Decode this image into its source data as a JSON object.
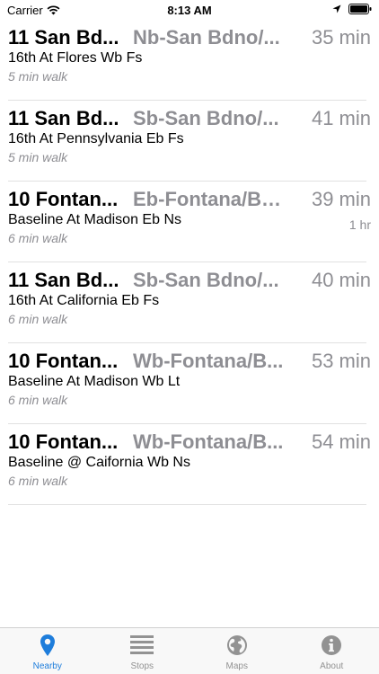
{
  "status_bar": {
    "carrier": "Carrier",
    "time": "8:13 AM",
    "icons": [
      "wifi-icon",
      "location-arrow-icon",
      "battery-icon"
    ]
  },
  "departures": [
    {
      "route": "11 San Bd...",
      "headsign": "Nb-San Bdno/...",
      "eta": "35 min",
      "eta_secondary": "",
      "stop": "16th At Flores Wb Fs",
      "walk": "5 min walk"
    },
    {
      "route": "11 San Bd...",
      "headsign": "Sb-San Bdno/...",
      "eta": "41 min",
      "eta_secondary": "",
      "stop": "16th At Pennsylvania Eb Fs",
      "walk": "5 min walk"
    },
    {
      "route": "10 Fontan...",
      "headsign": "Eb-Fontana/Ba...",
      "eta": "39 min",
      "eta_secondary": "1 hr",
      "stop": "Baseline At Madison Eb Ns",
      "walk": "6 min walk"
    },
    {
      "route": "11 San Bd...",
      "headsign": "Sb-San Bdno/...",
      "eta": "40 min",
      "eta_secondary": "",
      "stop": "16th At California Eb Fs",
      "walk": "6 min walk"
    },
    {
      "route": "10 Fontan...",
      "headsign": "Wb-Fontana/B...",
      "eta": "53 min",
      "eta_secondary": "",
      "stop": "Baseline At Madison Wb Lt",
      "walk": "6 min walk"
    },
    {
      "route": "10 Fontan...",
      "headsign": "Wb-Fontana/B...",
      "eta": "54 min",
      "eta_secondary": "",
      "stop": "Baseline @ Caifornia Wb Ns",
      "walk": "6 min walk"
    }
  ],
  "tab_bar": {
    "tabs": [
      {
        "label": "Nearby",
        "icon": "location-pin-icon",
        "active": true
      },
      {
        "label": "Stops",
        "icon": "list-lines-icon",
        "active": false
      },
      {
        "label": "Maps",
        "icon": "globe-icon",
        "active": false
      },
      {
        "label": "About",
        "icon": "info-icon",
        "active": false
      }
    ]
  },
  "colors": {
    "accent": "#1e7ddb",
    "secondary_text": "#8e8e93",
    "tab_inactive": "#929292"
  }
}
